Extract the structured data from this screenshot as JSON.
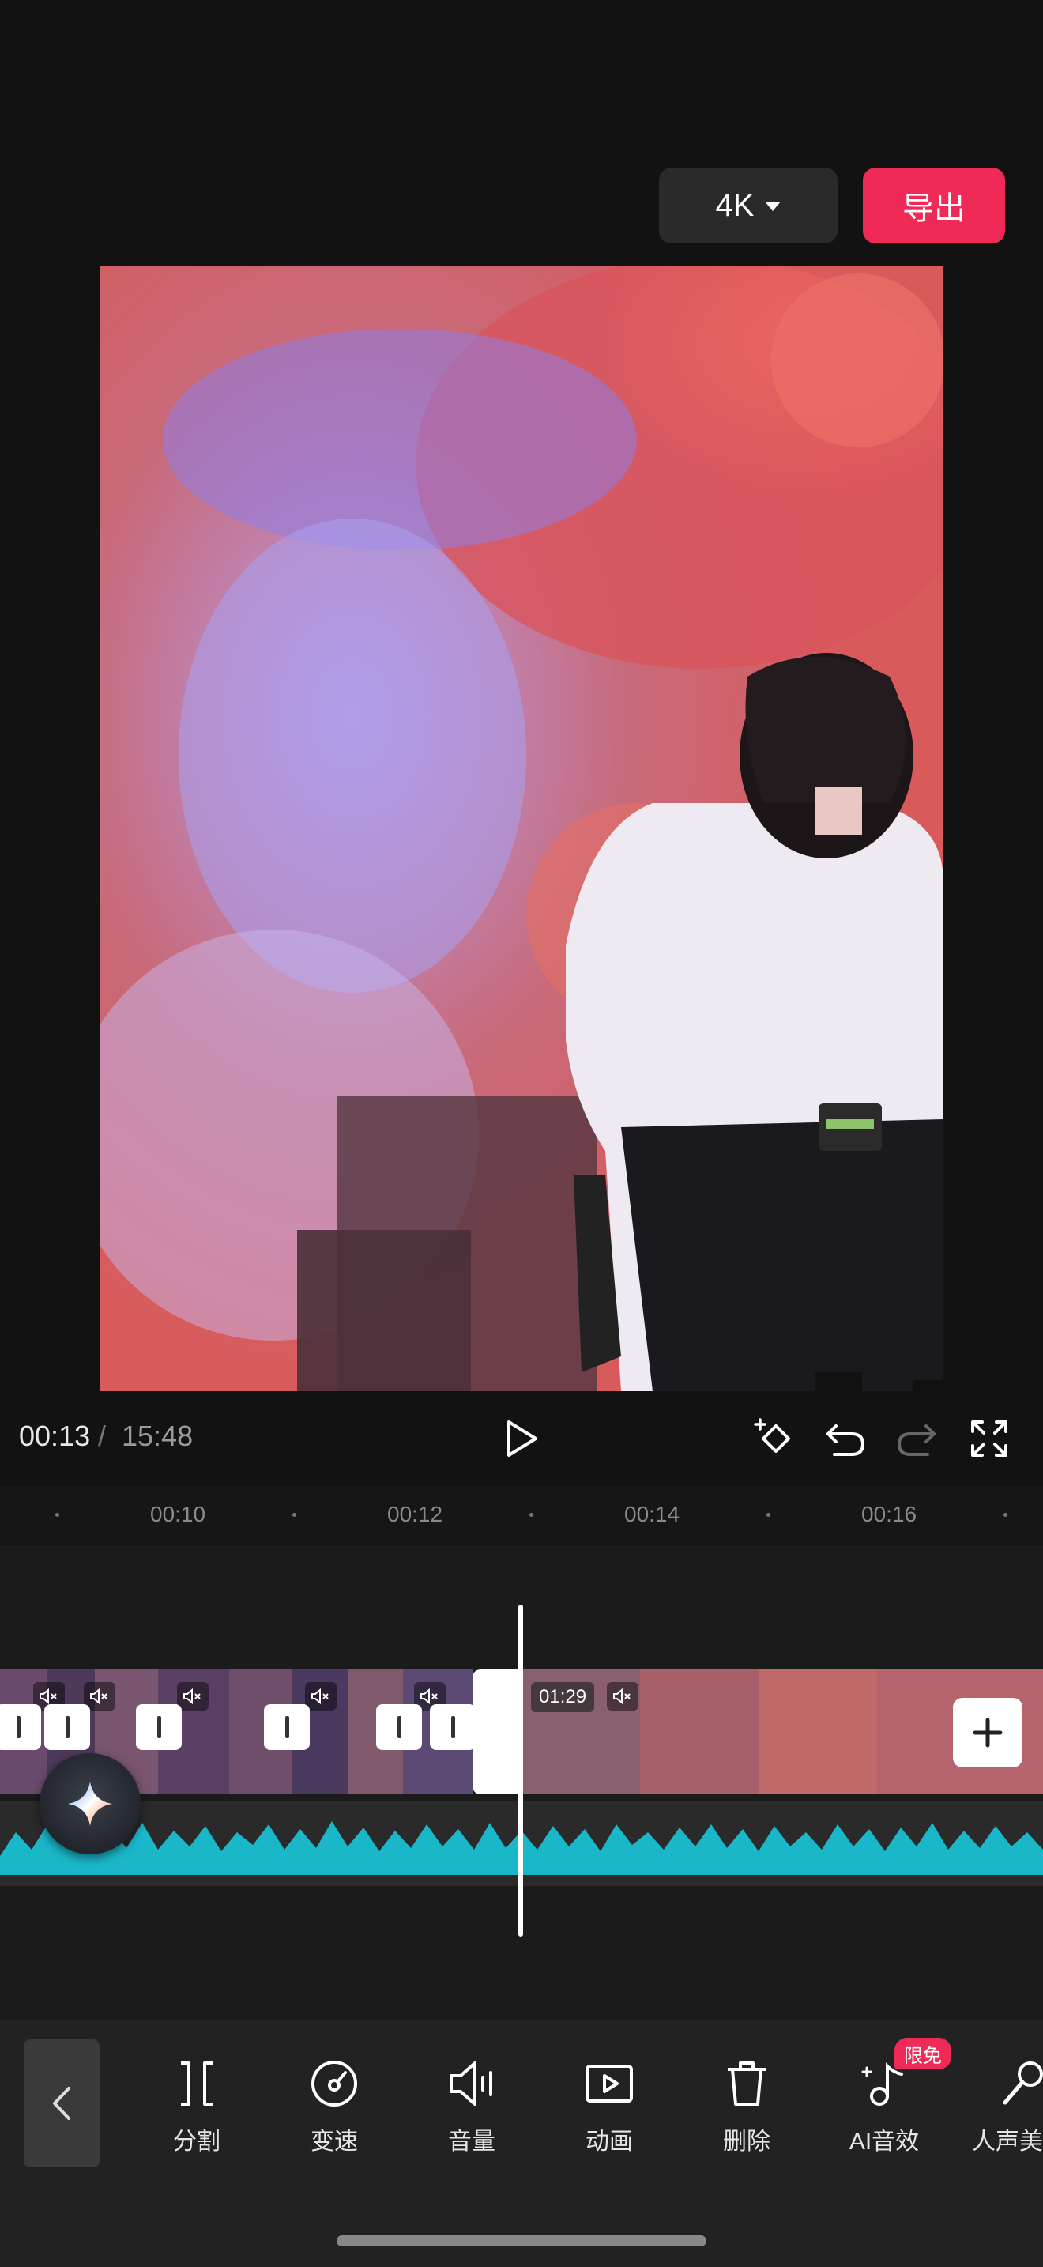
{
  "header": {
    "resolution": "4K",
    "export_label": "导出"
  },
  "playback": {
    "current_time": "00:13",
    "separator": "/",
    "total_time": "15:48"
  },
  "ruler": {
    "ticks": [
      "00:10",
      "00:12",
      "00:14",
      "00:16"
    ]
  },
  "clip": {
    "duration_badge": "01:29"
  },
  "toolbar": {
    "items": [
      {
        "label": "分割",
        "icon": "split-icon"
      },
      {
        "label": "变速",
        "icon": "speed-icon"
      },
      {
        "label": "音量",
        "icon": "volume-icon"
      },
      {
        "label": "动画",
        "icon": "animation-icon"
      },
      {
        "label": "删除",
        "icon": "delete-icon"
      },
      {
        "label": "AI音效",
        "icon": "ai-sound-icon"
      },
      {
        "label": "人声美",
        "icon": "voice-beauty-icon"
      }
    ],
    "ai_badge": "限免"
  },
  "colors": {
    "accent": "#f02a56",
    "waveform": "#1ab7c9",
    "background": "#121212"
  }
}
